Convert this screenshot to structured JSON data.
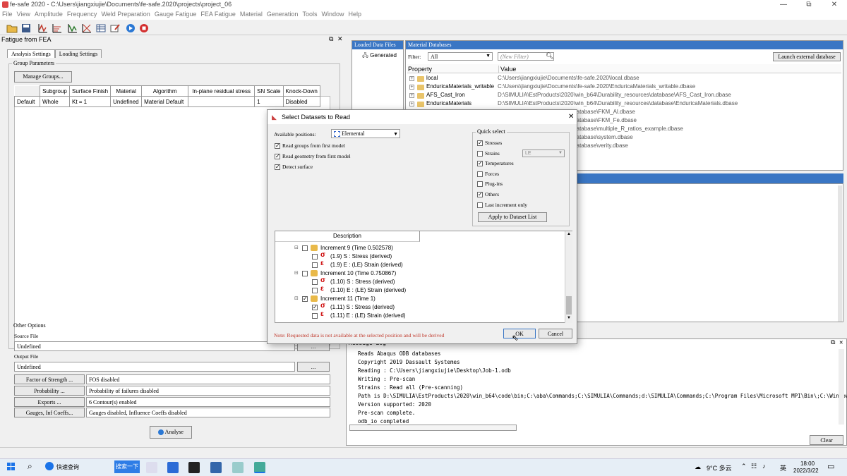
{
  "window": {
    "title": "fe-safe 2020 - C:\\Users\\jiangxiujie\\Documents\\fe-safe.2020\\projects\\project_06",
    "minimize": "—",
    "maximize": "⧉",
    "close": "✕"
  },
  "menu": [
    "File",
    "View",
    "Amplitude",
    "Frequency",
    "Weld Preparation",
    "Gauge Fatigue",
    "FEA Fatigue",
    "Material",
    "Generation",
    "Tools",
    "Window",
    "Help"
  ],
  "left_panel": {
    "title": "Fatigue from FEA",
    "tabs": [
      "Analysis Settings",
      "Loading Settings"
    ],
    "group_params_label": "Group Parameters",
    "manage_groups": "Manage Groups...",
    "table_headers": [
      "",
      "Subgroup",
      "Surface Finish",
      "Material",
      "Algorithm",
      "In-plane residual stress",
      "SN Scale",
      "Knock-Down"
    ],
    "table_row": [
      "Default",
      "Whole",
      "Kt = 1",
      "Undefined",
      "Material Default",
      "",
      "1",
      "Disabled"
    ],
    "other_options": "Other Options",
    "source_file_label": "Source File",
    "source_file_value": "Undefined",
    "output_file_label": "Output File",
    "output_file_value": "Undefined",
    "browse": "...",
    "options": [
      {
        "button": "Factor of Strength ...",
        "value": "FOS disabled"
      },
      {
        "button": "Probability ...",
        "value": "Probability of failures disabled"
      },
      {
        "button": "Exports ...",
        "value": "6 Contour(s) enabled"
      },
      {
        "button": "Gauges, Inf Coeffs...",
        "value": "Gauges disabled, Influence Coeffs disabled"
      }
    ],
    "analyse": "Analyse"
  },
  "loaded_data": {
    "header": "Loaded Data Files",
    "item": "Generated"
  },
  "material_db": {
    "header": "Material Databases",
    "filter_label": "Filter:",
    "filter_value": "All",
    "new_filter_placeholder": "(New Filter)",
    "launch": "Launch external database",
    "col_property": "Property",
    "col_value": "Value",
    "rows": [
      {
        "p": "local",
        "v": "C:\\Users\\jiangxiujie\\Documents\\fe-safe.2020\\local.dbase"
      },
      {
        "p": "EnduricaMaterials_writable",
        "v": "C:\\Users\\jiangxiujie\\Documents\\fe-safe.2020\\EnduricaMaterials_writable.dbase"
      },
      {
        "p": "AFS_Cast_Iron",
        "v": "D:\\SIMULIA\\EstProducts\\2020\\win_b64\\Durability_resources\\database\\AFS_Cast_Iron.dbase"
      },
      {
        "p": "EnduricaMaterials",
        "v": "D:\\SIMULIA\\EstProducts\\2020\\win_b64\\Durability_resources\\database\\EnduricaMaterials.dbase"
      },
      {
        "p": "",
        "v": "win_b64\\Durability_resources\\database\\FKM_Al.dbase"
      },
      {
        "p": "",
        "v": "win_b64\\Durability_resources\\database\\FKM_Fe.dbase"
      },
      {
        "p": "",
        "v": "win_b64\\Durability_resources\\database\\multiple_R_ratios_example.dbase"
      },
      {
        "p": "",
        "v": "win_b64\\Durability_resources\\database\\system.dbase"
      },
      {
        "p": "",
        "v": "win_b64\\Durability_resources\\database\\verity.dbase"
      }
    ]
  },
  "message_log": {
    "header": "Message Log",
    "lines": [
      "Reads Abaqus ODB databases",
      "Copyright 2019 Dassault Systemes",
      "Reading : C:\\Users\\jiangxiujie\\Desktop\\Job-1.odb",
      "Writing : Pre-scan",
      "Strains : Read all (Pre-scanning)",
      "Path is D:\\SIMULIA\\EstProducts\\2020\\win_b64\\code\\bin;C:\\aba\\Commands;C:\\SIMULIA\\Commands;d:\\SIMULIA\\Commands;C:\\Program Files\\Microsoft MPI\\Bin\\;C:\\Windows\\",
      "Version supported: 2020",
      "Pre-scan complete.",
      "odb_io completed"
    ],
    "clear": "Clear"
  },
  "dialog": {
    "title": "Select Datasets to Read",
    "close": "✕",
    "available_positions_label": "Available positions:",
    "available_positions_value": "Elemental",
    "options": [
      {
        "label": "Read groups from first model",
        "checked": true
      },
      {
        "label": "Read geometry from first model",
        "checked": true
      },
      {
        "label": "Detect surface",
        "checked": true
      }
    ],
    "quick_select": "Quick select",
    "quick": [
      {
        "label": "Stresses",
        "checked": true
      },
      {
        "label": "Strains",
        "checked": false
      },
      {
        "label": "Temperatures",
        "checked": true
      },
      {
        "label": "Forces",
        "checked": false
      },
      {
        "label": "Plug-ins",
        "checked": false
      },
      {
        "label": "Others",
        "checked": true
      },
      {
        "label": "Last increment only",
        "checked": false
      }
    ],
    "strain_type": "LE",
    "apply": "Apply to Dataset List",
    "description_header": "Description",
    "tree": [
      {
        "indent": 0,
        "kind": "inc",
        "text": "Increment 9 (Time 0.502578)",
        "checked": false
      },
      {
        "indent": 1,
        "kind": "s",
        "text": "(1.9) S : Stress (derived)",
        "checked": false
      },
      {
        "indent": 1,
        "kind": "e",
        "text": "(1.9) E : (LE) Strain (derived)",
        "checked": false
      },
      {
        "indent": 0,
        "kind": "inc",
        "text": "Increment 10 (Time 0.750867)",
        "checked": false
      },
      {
        "indent": 1,
        "kind": "s",
        "text": "(1.10) S : Stress (derived)",
        "checked": false
      },
      {
        "indent": 1,
        "kind": "e",
        "text": "(1.10) E : (LE) Strain (derived)",
        "checked": false
      },
      {
        "indent": 0,
        "kind": "inc",
        "text": "Increment 11 (Time 1)",
        "checked": true
      },
      {
        "indent": 1,
        "kind": "s",
        "text": "(1.11) S : Stress (derived)",
        "checked": true
      },
      {
        "indent": 1,
        "kind": "e",
        "text": "(1.11) E : (LE) Strain (derived)",
        "checked": false
      }
    ],
    "note": "Note: Requested data is not available at the selected position and will be derived",
    "ok": "OK",
    "cancel": "Cancel"
  },
  "taskbar": {
    "search": "快速查询",
    "search_btn": "搜索一下",
    "weather": "9°C 多云",
    "ime": "英",
    "time": "18:00",
    "date": "2022/3/22"
  },
  "colors": {
    "accent": "#3a76c4",
    "note": "#c0392b"
  }
}
